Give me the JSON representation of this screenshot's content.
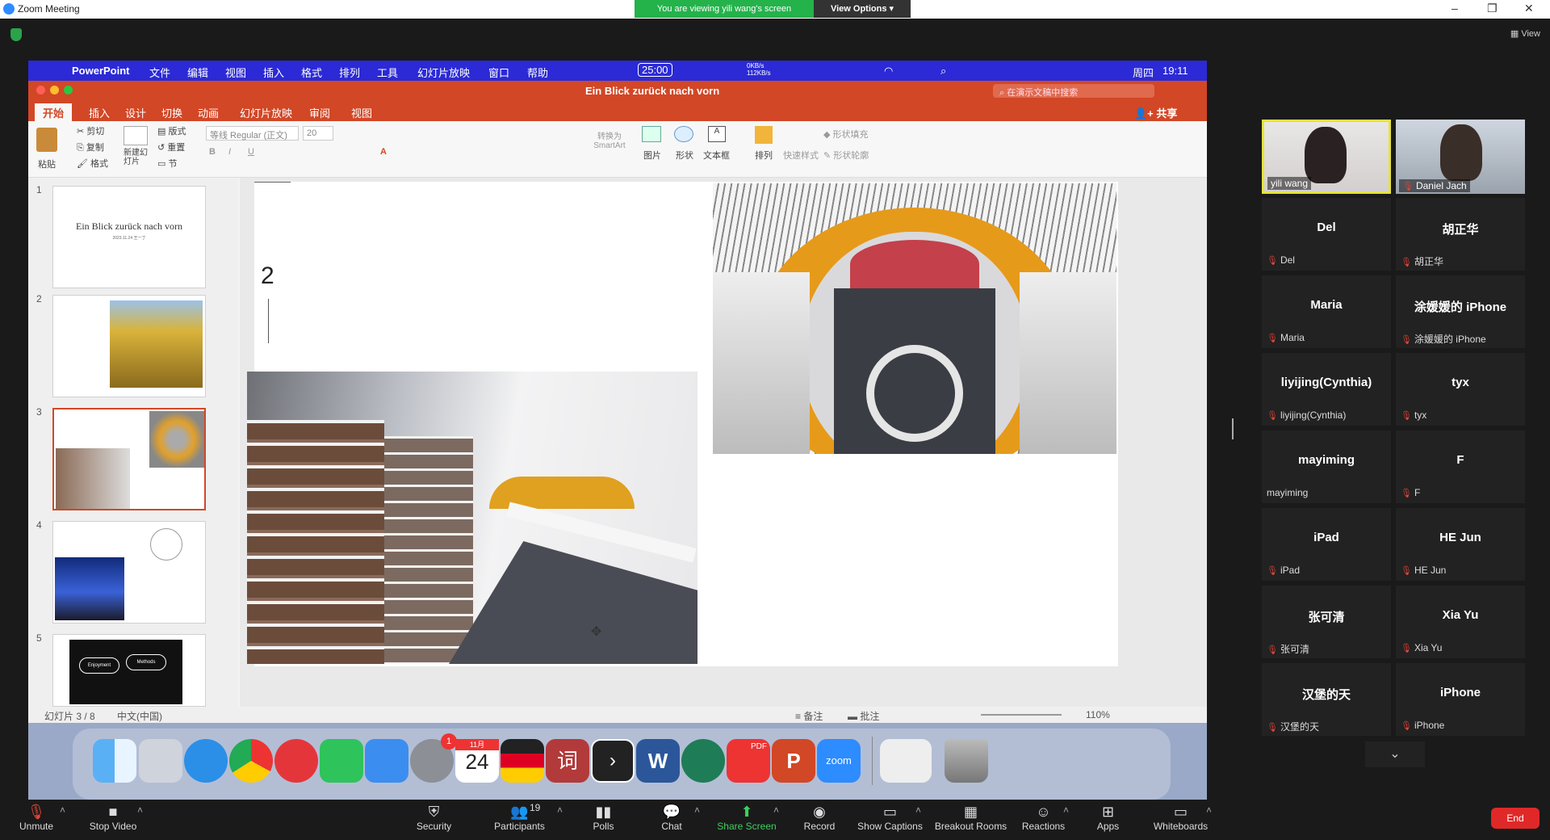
{
  "window": {
    "title": "Zoom Meeting",
    "viewing_banner": "You are viewing yili wang's screen",
    "view_options": "View Options",
    "view_label": "View"
  },
  "mac_menu": {
    "app": "PowerPoint",
    "items": [
      "文件",
      "编辑",
      "视图",
      "插入",
      "格式",
      "排列",
      "工具",
      "幻灯片放映",
      "窗口",
      "帮助"
    ],
    "timer": "25:00",
    "net_up": "0KB/s",
    "net_down": "112KB/s",
    "day": "周四",
    "time": "19:11"
  },
  "ppt": {
    "doc_title": "Ein Blick zurück nach vorn",
    "search_placeholder": "在演示文稿中搜索",
    "share": "共享",
    "tabs": [
      "开始",
      "插入",
      "设计",
      "切换",
      "动画",
      "幻灯片放映",
      "审阅",
      "视图"
    ],
    "ribbon": {
      "paste": "粘贴",
      "cut": "剪切",
      "copy": "复制",
      "format": "格式",
      "new_slide": "新建幻灯片",
      "layout": "版式",
      "reset": "重置",
      "section": "节",
      "font": "等线 Regular (正文)",
      "size": "20",
      "smartart": "转换为SmartArt",
      "picture": "图片",
      "shape": "形状",
      "textbox": "文本框",
      "arrange": "排列",
      "quick_style": "快速样式",
      "shape_fill": "形状填充",
      "shape_outline": "形状轮廓"
    },
    "thumbs": [
      {
        "num": "1",
        "title": "Ein Blick zurück nach vorn",
        "sub": "2023.11.24 王一丁"
      },
      {
        "num": "2"
      },
      {
        "num": "3"
      },
      {
        "num": "4"
      },
      {
        "num": "5",
        "bubble1": "Enjoyment",
        "bubble2": "Methods"
      }
    ],
    "slide_number": "2",
    "status": {
      "slide": "幻灯片 3 / 8",
      "lang": "中文(中国)",
      "notes": "备注",
      "comments": "批注",
      "zoom": "110%"
    }
  },
  "participants": [
    {
      "name": "yili wang",
      "video": true
    },
    {
      "name": "Daniel Jach",
      "video": true
    },
    {
      "name": "Del",
      "label": "Del"
    },
    {
      "name": "胡正华",
      "label": "胡正华"
    },
    {
      "name": "Maria",
      "label": "Maria"
    },
    {
      "name": "涂媛媛的 iPhone",
      "label": "涂媛媛的 iPhone"
    },
    {
      "name": "liyijing(Cynthia)",
      "label": "liyijing(Cynthia)"
    },
    {
      "name": "tyx",
      "label": "tyx"
    },
    {
      "name": "mayiming",
      "label": "mayiming"
    },
    {
      "name": "F",
      "label": "F"
    },
    {
      "name": "iPad",
      "label": "iPad"
    },
    {
      "name": "HE Jun",
      "label": "HE Jun"
    },
    {
      "name": "张可清",
      "label": "张可清"
    },
    {
      "name": "Xia Yu",
      "label": "Xia Yu"
    },
    {
      "name": "汉堡的天",
      "label": "汉堡的天"
    },
    {
      "name": "iPhone",
      "label": "iPhone"
    }
  ],
  "toolbar": {
    "unmute": "Unmute",
    "stop_video": "Stop Video",
    "security": "Security",
    "participants": "Participants",
    "participants_count": "19",
    "polls": "Polls",
    "chat": "Chat",
    "share_screen": "Share Screen",
    "record": "Record",
    "captions": "Show Captions",
    "breakout": "Breakout Rooms",
    "reactions": "Reactions",
    "apps": "Apps",
    "whiteboards": "Whiteboards",
    "end": "End"
  },
  "dock": {
    "calendar_month": "11月",
    "calendar_day": "24",
    "settings_badge": "1",
    "zoom": "zoom",
    "word": "W",
    "ppt": "P",
    "pdf": "PDF",
    "ci": "词"
  }
}
